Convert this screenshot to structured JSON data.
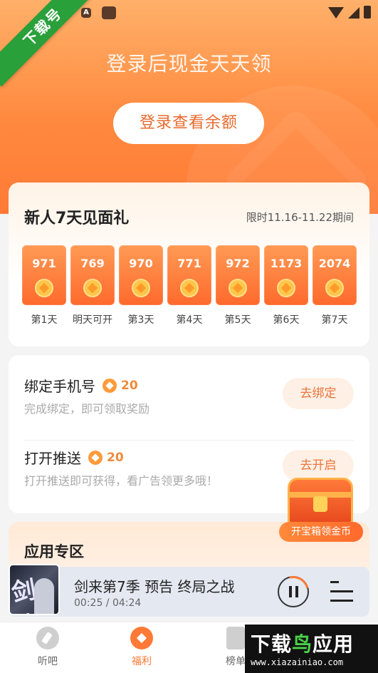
{
  "status_bar": {
    "a_icon": "A"
  },
  "ribbon": {
    "text": "下载号"
  },
  "hero": {
    "title": "登录后现金天天领",
    "login_button": "登录查看余额"
  },
  "gift": {
    "title": "新人7天见面礼",
    "period": "限时11.16-11.22期间",
    "days": [
      {
        "amount": "971",
        "label": "第1天"
      },
      {
        "amount": "769",
        "label": "明天可开"
      },
      {
        "amount": "970",
        "label": "第3天"
      },
      {
        "amount": "771",
        "label": "第4天"
      },
      {
        "amount": "972",
        "label": "第5天"
      },
      {
        "amount": "1173",
        "label": "第6天"
      },
      {
        "amount": "2074",
        "label": "第7天"
      }
    ]
  },
  "tasks": [
    {
      "title": "绑定手机号",
      "reward": "20",
      "desc": "完成绑定，即可领取奖励",
      "button": "去绑定"
    },
    {
      "title": "打开推送",
      "reward": "20",
      "desc": "打开推送即可获得，看广告领更多哦！",
      "button": "去开启"
    }
  ],
  "chest": {
    "label": "开宝箱领金币"
  },
  "apps": {
    "title": "应用专区"
  },
  "player": {
    "title": "剑来第7季 预告 终局之战",
    "time": "00:25 / 04:24",
    "cover_text": "剑来"
  },
  "tabs": [
    {
      "label": "听吧"
    },
    {
      "label": "福利"
    },
    {
      "label": "榜单"
    }
  ],
  "watermark": {
    "main_a": "下载",
    "main_b": "鸟",
    "main_c": "应用",
    "sub": "www.xiazainiao.com"
  },
  "colors": {
    "accent": "#ff7a36",
    "reward": "#f08a3a",
    "ribbon": "#2aa03a"
  }
}
